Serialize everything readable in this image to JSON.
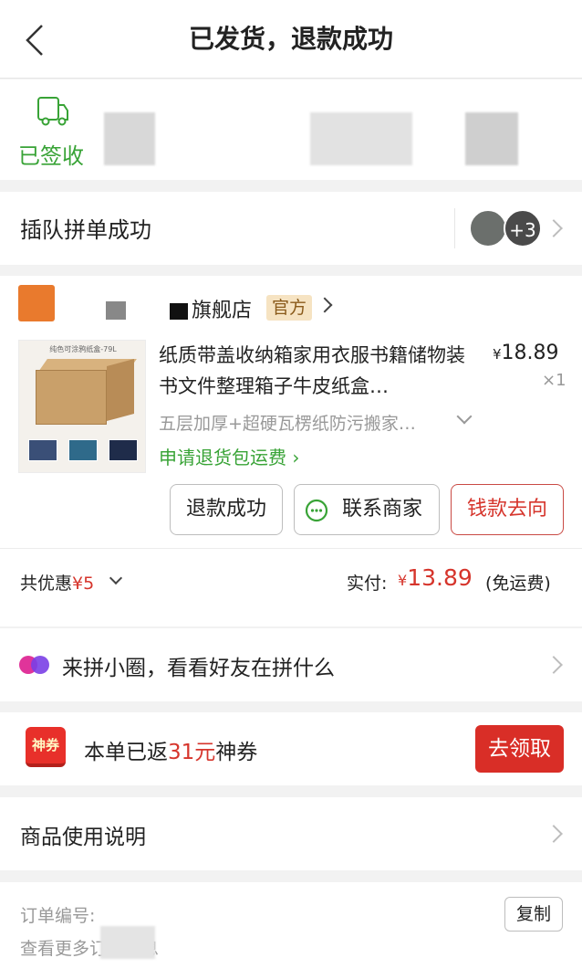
{
  "header": {
    "title": "已发货，退款成功"
  },
  "logistics": {
    "status": "已签收"
  },
  "group": {
    "text": "插队拼单成功",
    "extra_count": "+3"
  },
  "order": {
    "shop_name": "旗舰店",
    "official_badge": "官方",
    "thumb_caption": "纯色可涂鸦纸盒-79L",
    "product_title": "纸质带盖收纳箱家用衣服书籍储物装书文件整理箱子牛皮纸盒…",
    "price_symbol": "¥",
    "price": "18.89",
    "quantity": "×1",
    "spec": "五层加厚+超硬瓦楞纸防污搬家…",
    "return_link": "申请退货包运费",
    "buttons": {
      "refund": "退款成功",
      "contact": "联系商家",
      "money": "钱款去向"
    },
    "discount_label": "共优惠",
    "discount_value": "¥5",
    "paid_label": "实付:",
    "paid_symbol": "¥",
    "paid_amount": "13.89",
    "shipping_note": "(免运费)"
  },
  "circle": {
    "text": "来拼小圈，看看好友在拼什么"
  },
  "coupon": {
    "icon_text": "神券",
    "text_prefix": "本单已返",
    "amount": "31元",
    "text_suffix": "神券",
    "claim_button": "去领取"
  },
  "instructions": {
    "text": "商品使用说明"
  },
  "order_info": {
    "order_no_label": "订单编号:",
    "more_info": "查看更多订单信息",
    "copy_button": "复制"
  },
  "colors": {
    "green": "#38a336",
    "red": "#d6352c",
    "button_red": "#d92e27"
  }
}
